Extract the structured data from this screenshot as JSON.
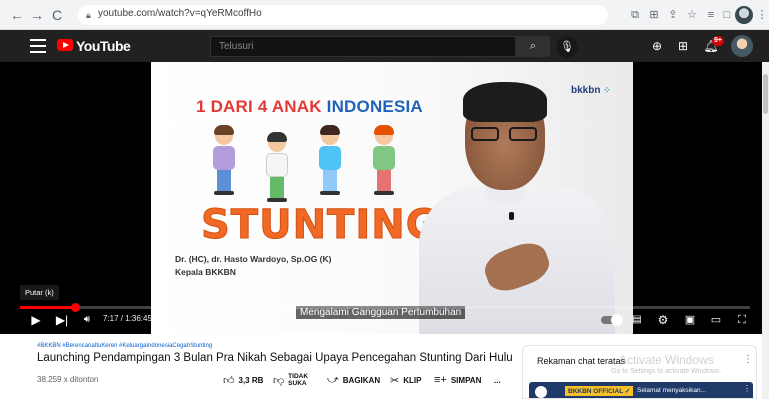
{
  "browser": {
    "url": "youtube.com/watch?v=qYeRMcoffHo",
    "back_icon": "arrow-left-icon",
    "forward_icon": "arrow-right-icon",
    "reload_icon": "reload-icon"
  },
  "youtube_header": {
    "logo_text": "YouTube",
    "search_placeholder": "Telusuri",
    "notification_count": "9+"
  },
  "video_frame": {
    "headline_part1": "1 DARI 4 ANAK",
    "headline_part2": "INDONESIA",
    "big_word": "STUNTING",
    "speaker_name": "Dr. (HC), dr. Hasto Wardoyo, Sp.OG (K)",
    "speaker_role": "Kepala BKKBN",
    "logo": "bkkbn"
  },
  "player": {
    "tooltip": "Putar (k)",
    "caption": "Mengalami Gangguan Pertumbuhan",
    "time": "7:17 / 1:36:45",
    "progress_fraction": 0.075
  },
  "video_info": {
    "hashtags": "#BKKBN #BerencanaItuKeren #KeluargaIndonesiaCegahStunting",
    "title": "Launching Pendampingan 3 Bulan Pra Nikah Sebagai Upaya Pencegahan Stunting Dari Hulu",
    "views": "38.259 x ditonton",
    "like_count": "3,3 RB",
    "dislike_label_1": "TIDAK",
    "dislike_label_2": "SUKA",
    "share_label": "BAGIKAN",
    "clip_label": "KLIP",
    "save_label": "SIMPAN",
    "more_label": "..."
  },
  "chat": {
    "title": "Rekaman chat teratas",
    "watermark": "Activate Windows",
    "watermark_sub": "Go to Settings to activate Windows.",
    "author": "BKKBN OFFICIAL ✓",
    "message": "Selamat menyaksikan..."
  },
  "colors": {
    "youtube_red": "#ff0000",
    "header_bg": "#212121",
    "stunting_orange": "#f06a25",
    "headline_blue": "#1e63b8",
    "headline_red": "#e53935"
  }
}
